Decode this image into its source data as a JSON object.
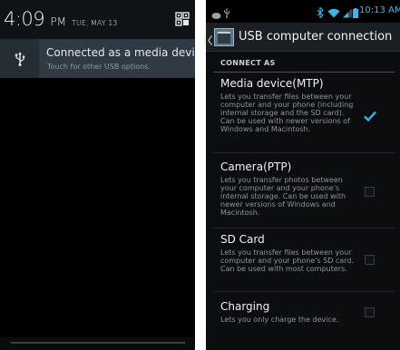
{
  "notification_shade": {
    "time": "4:09",
    "ampm": "PM",
    "date": "TUE, MAY 13",
    "quick_settings_icon": "quick-settings-icon",
    "notification": {
      "icon": "usb-icon",
      "title": "Connected as a media device",
      "subtitle": "Touch for other USB options."
    }
  },
  "settings_screen": {
    "status_bar": {
      "time": "10:13 AM",
      "icons": [
        "notification-icon",
        "usb-icon",
        "bluetooth-icon",
        "wifi-icon",
        "signal-icon",
        "battery-icon"
      ]
    },
    "title": "USB computer connection",
    "section": "CONNECT AS",
    "options": [
      {
        "title": "Media device(MTP)",
        "description": "Lets you transfer files between your computer and your phone (including internal storage and the SD card). Can be used with newer versions of Windows and Macintosh.",
        "checked": true
      },
      {
        "title": "Camera(PTP)",
        "description": "Lets you transfer photos between your computer and your phone's internal storage. Can be used with newer versions of Windows and Macintosh.",
        "checked": false
      },
      {
        "title": "SD Card",
        "description": "Lets you transfer files between your computer and your phone's SD card. Can be used with most computers.",
        "checked": false
      },
      {
        "title": "Charging",
        "description": "Lets you only charge the device.",
        "checked": false
      }
    ]
  },
  "colors": {
    "accent": "#33b5e5",
    "notification_bg": "#303a44",
    "action_bar_bg": "#1b1e22",
    "background": "#000000"
  }
}
